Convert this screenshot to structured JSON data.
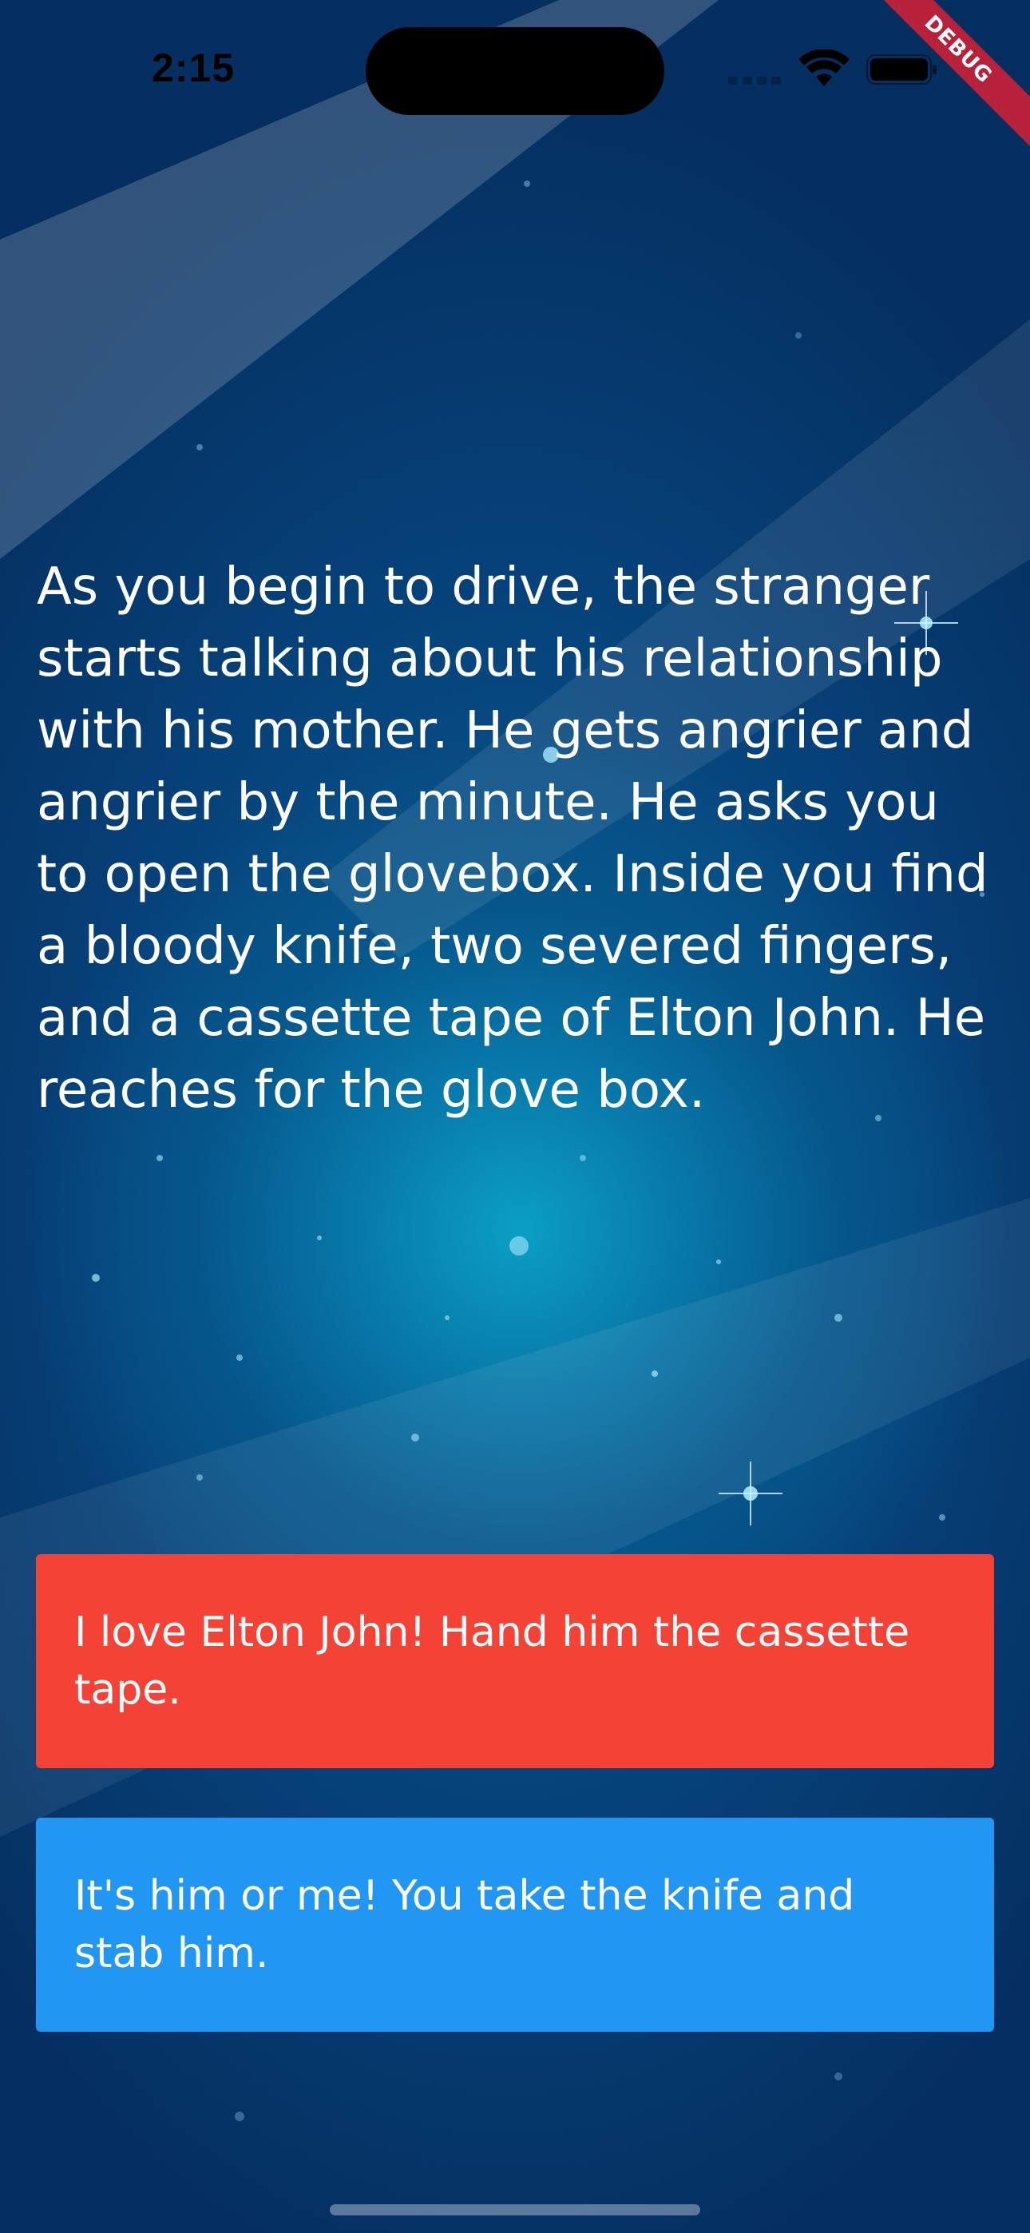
{
  "status_bar": {
    "time": "2:15"
  },
  "debug_banner": "DEBUG",
  "story": {
    "text": "As you begin to drive, the stranger starts talking about his relationship with his mother. He gets angrier and angrier by the minute. He asks you to open the glovebox. Inside you find a bloody knife, two severed fingers, and a cassette tape of Elton John. He reaches for the glove box."
  },
  "choices": [
    {
      "label": "I love Elton John! Hand him the cassette tape.",
      "color": "#f44336"
    },
    {
      "label": "It's him or me! You take the knife and stab him.",
      "color": "#2196f3"
    }
  ],
  "colors": {
    "background": "#06427a",
    "background_glow": "#0b9fc4",
    "text": "#ffffff",
    "debug": "#b8213a"
  },
  "icons": [
    "signal-icon",
    "wifi-icon",
    "battery-icon"
  ]
}
